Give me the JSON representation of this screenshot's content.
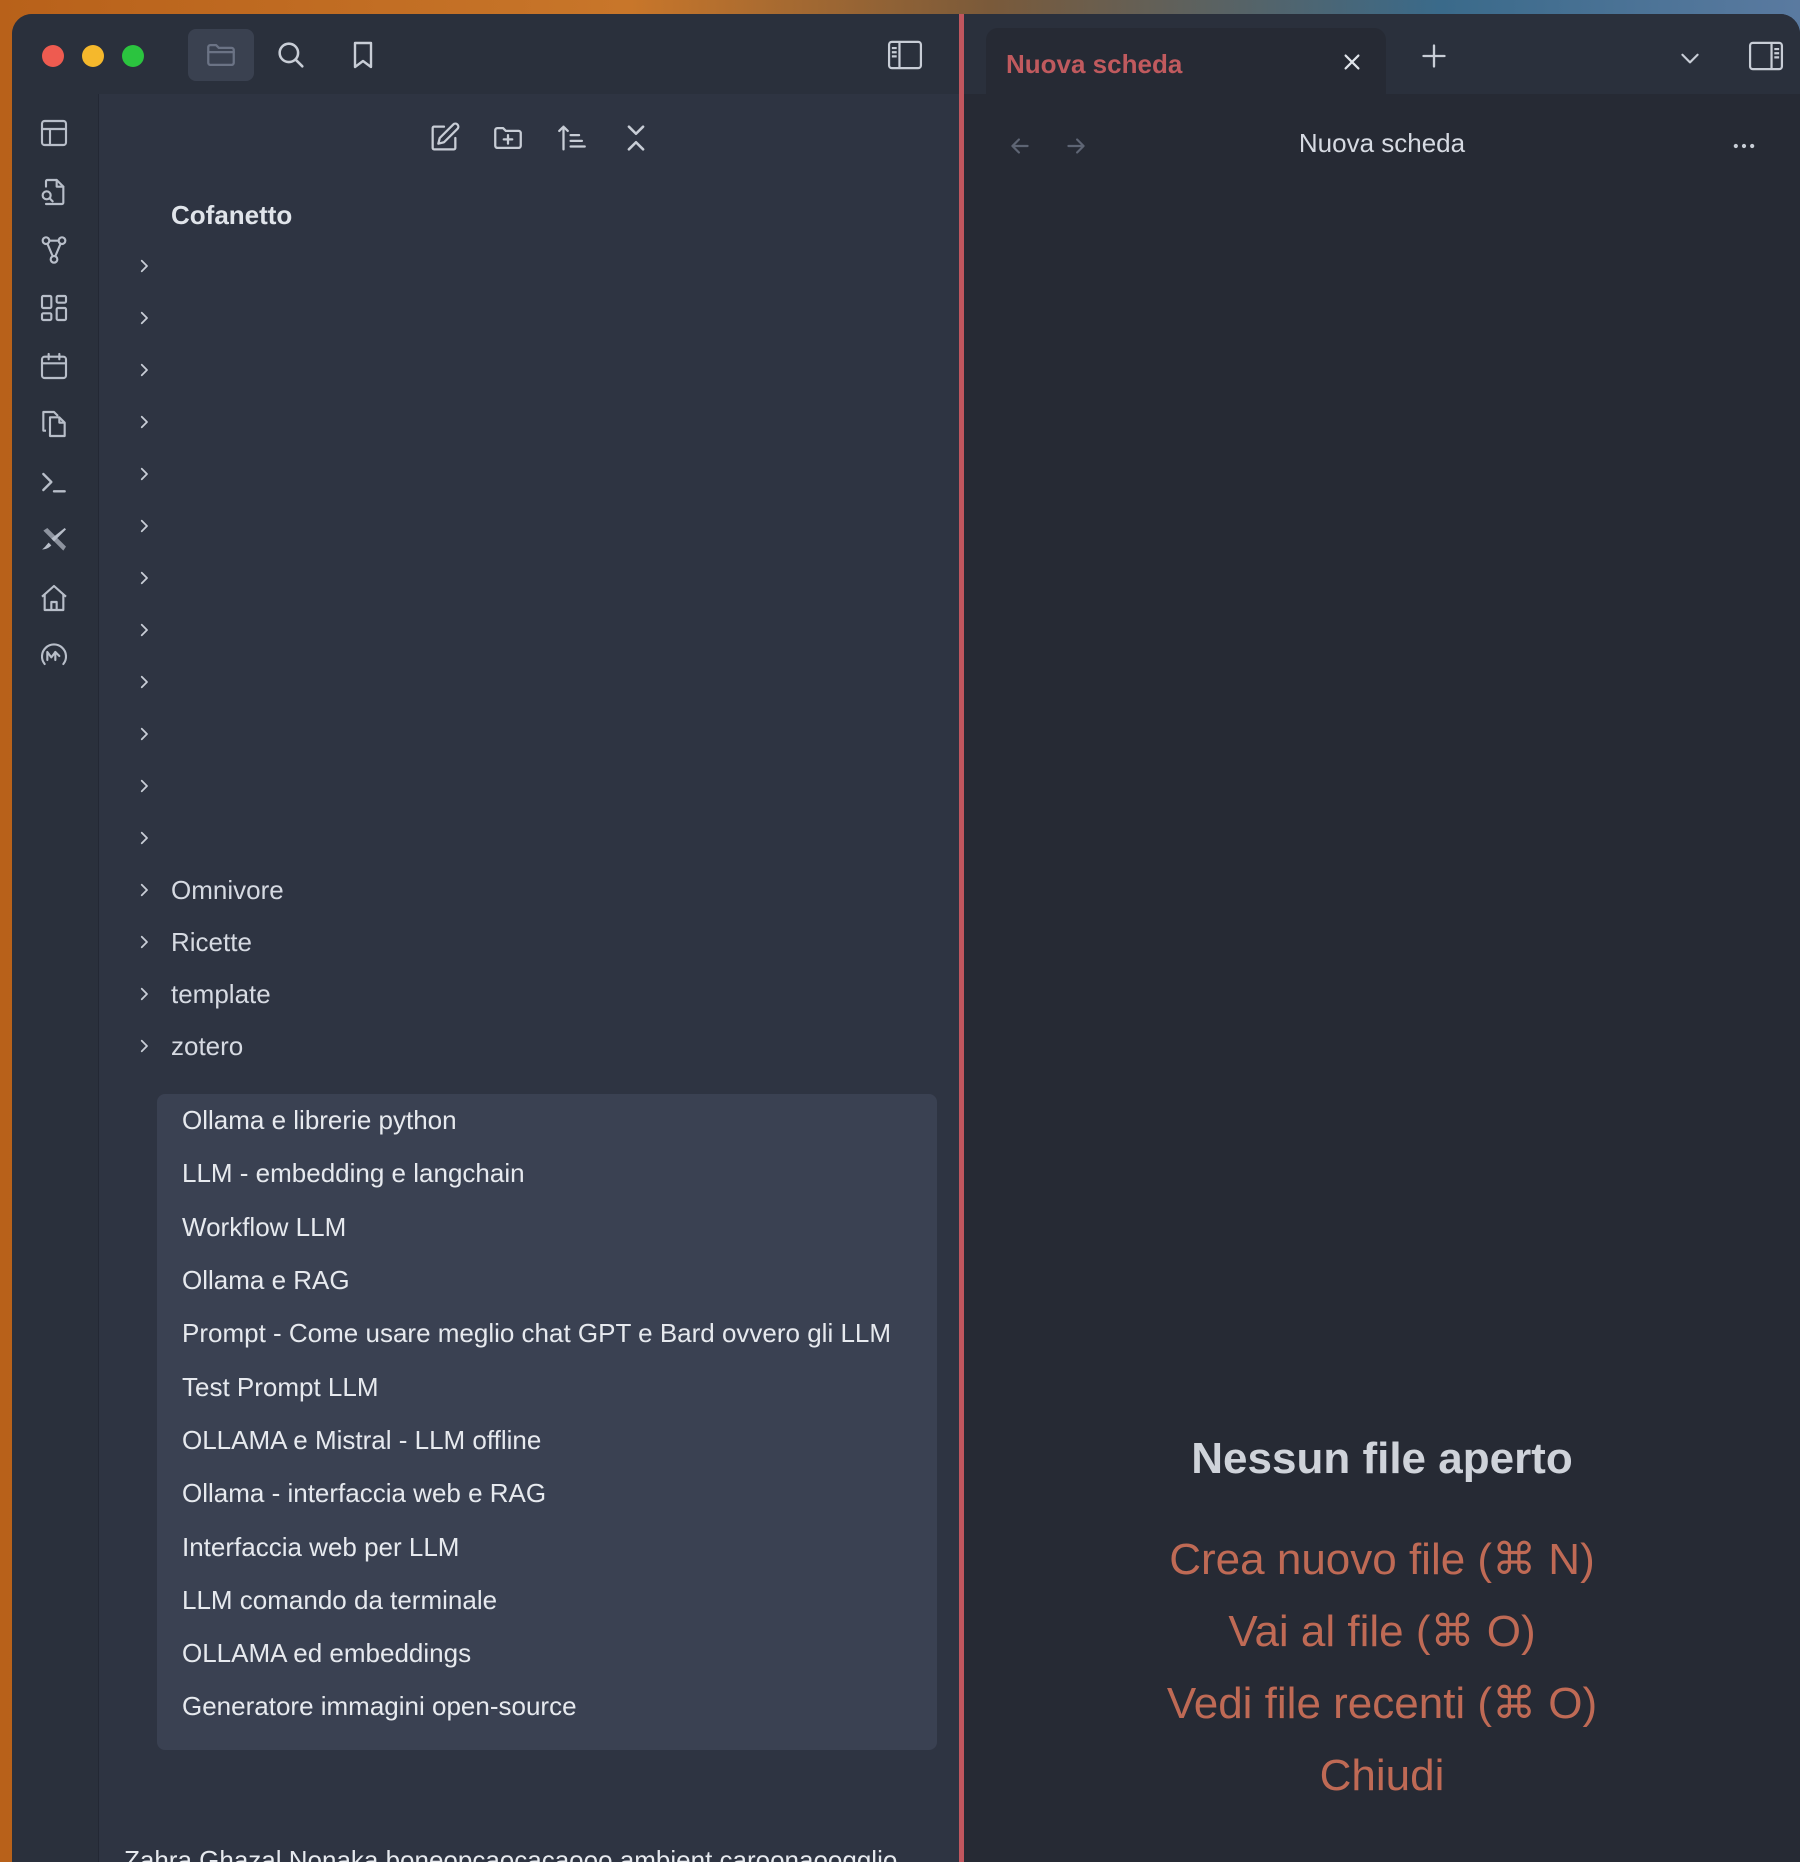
{
  "colors": {
    "accent": "#c0565e",
    "action": "#bf6a55",
    "sidebar_bg": "#2e3442",
    "editor_bg": "#262a34"
  },
  "toolbar": {
    "icons": [
      "folder-icon",
      "search-icon",
      "bookmark-icon",
      "sidebar-toggle-icon"
    ],
    "active": "folder-icon"
  },
  "ribbon": {
    "icons": [
      "canvas-icon",
      "file-search-icon",
      "graph-icon",
      "dashboard-icon",
      "calendar-icon",
      "copy-files-icon",
      "terminal-icon",
      "excalidraw-icon",
      "home-icon",
      "omnivore-icon"
    ]
  },
  "explorer": {
    "nav_icons": [
      "new-note-icon",
      "new-folder-icon",
      "sort-icon",
      "collapse-all-icon"
    ],
    "vault_name": "Cofanetto",
    "folders": [
      {
        "label": ""
      },
      {
        "label": ""
      },
      {
        "label": ""
      },
      {
        "label": ""
      },
      {
        "label": ""
      },
      {
        "label": ""
      },
      {
        "label": ""
      },
      {
        "label": ""
      },
      {
        "label": ""
      },
      {
        "label": ""
      },
      {
        "label": ""
      },
      {
        "label": ""
      },
      {
        "label": "Omnivore"
      },
      {
        "label": "Ricette"
      },
      {
        "label": "template"
      },
      {
        "label": "zotero"
      }
    ],
    "files": [
      "Ollama e librerie python",
      "LLM - embedding e langchain",
      "Workflow LLM",
      "Ollama e RAG",
      "Prompt - Come usare meglio chat GPT e Bard ovvero gli LLM",
      "Test Prompt LLM",
      "OLLAMA e Mistral - LLM offline",
      "Ollama - interfaccia web e RAG",
      "Interfaccia web per LLM",
      "LLM comando da terminale",
      "OLLAMA ed embeddings",
      "Generatore immagini open-source"
    ],
    "partial_file": "Zahra Ghazal Nonaka boneopcaocacaooo ambient caroonaoogglio"
  },
  "tabs": [
    {
      "label": "Nuova scheda",
      "active": true
    }
  ],
  "view": {
    "title": "Nuova scheda",
    "empty_title": "Nessun file aperto",
    "actions": [
      "Crea nuovo file (⌘ N)",
      "Vai al file (⌘ O)",
      "Vedi file recenti (⌘ O)",
      "Chiudi"
    ]
  }
}
